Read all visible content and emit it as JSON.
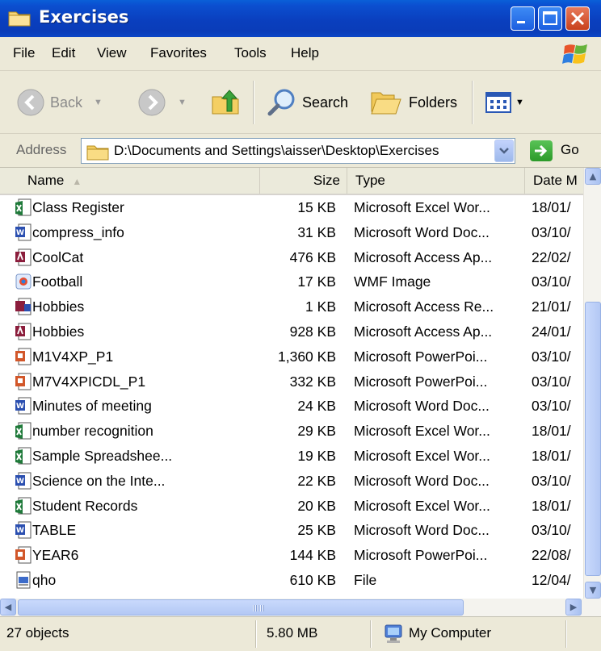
{
  "window": {
    "title": "Exercises"
  },
  "menu": [
    "File",
    "Edit",
    "View",
    "Favorites",
    "Tools",
    "Help"
  ],
  "toolbar": {
    "back": "Back",
    "search": "Search",
    "folders": "Folders"
  },
  "address": {
    "label": "Address",
    "path": "D:\\Documents and Settings\\aisser\\Desktop\\Exercises",
    "go": "Go"
  },
  "columns": {
    "name": "Name",
    "size": "Size",
    "type": "Type",
    "date": "Date M"
  },
  "files": [
    {
      "name": "Class Register",
      "size": "15 KB",
      "type": "Microsoft Excel Wor...",
      "date": "18/01/",
      "icon": "excel-file-icon"
    },
    {
      "name": "compress_info",
      "size": "31 KB",
      "type": "Microsoft Word Doc...",
      "date": "03/10/",
      "icon": "word-file-icon"
    },
    {
      "name": "CoolCat",
      "size": "476 KB",
      "type": "Microsoft Access Ap...",
      "date": "22/02/",
      "icon": "access-file-icon"
    },
    {
      "name": "Football",
      "size": "17 KB",
      "type": "WMF Image",
      "date": "03/10/",
      "icon": "image-file-icon"
    },
    {
      "name": "Hobbies",
      "size": "1 KB",
      "type": "Microsoft Access Re...",
      "date": "21/01/",
      "icon": "access-report-icon"
    },
    {
      "name": "Hobbies",
      "size": "928 KB",
      "type": "Microsoft Access Ap...",
      "date": "24/01/",
      "icon": "access-file-icon"
    },
    {
      "name": "M1V4XP_P1",
      "size": "1,360 KB",
      "type": "Microsoft PowerPoi...",
      "date": "03/10/",
      "icon": "powerpoint-file-icon"
    },
    {
      "name": "M7V4XPICDL_P1",
      "size": "332 KB",
      "type": "Microsoft PowerPoi...",
      "date": "03/10/",
      "icon": "powerpoint-file-icon"
    },
    {
      "name": "Minutes of meeting",
      "size": "24 KB",
      "type": "Microsoft Word Doc...",
      "date": "03/10/",
      "icon": "word-file-icon"
    },
    {
      "name": "number recognition",
      "size": "29 KB",
      "type": "Microsoft Excel Wor...",
      "date": "18/01/",
      "icon": "excel-file-icon"
    },
    {
      "name": "Sample Spreadshee...",
      "size": "19 KB",
      "type": "Microsoft Excel Wor...",
      "date": "18/01/",
      "icon": "excel-file-icon"
    },
    {
      "name": "Science on the Inte...",
      "size": "22 KB",
      "type": "Microsoft Word Doc...",
      "date": "03/10/",
      "icon": "word-file-icon"
    },
    {
      "name": "Student Records",
      "size": "20 KB",
      "type": "Microsoft Excel Wor...",
      "date": "18/01/",
      "icon": "excel-file-icon"
    },
    {
      "name": "TABLE",
      "size": "25 KB",
      "type": "Microsoft Word Doc...",
      "date": "03/10/",
      "icon": "word-file-icon"
    },
    {
      "name": "YEAR6",
      "size": "144 KB",
      "type": "Microsoft PowerPoi...",
      "date": "22/08/",
      "icon": "powerpoint-file-icon"
    },
    {
      "name": "qho",
      "size": "610 KB",
      "type": "File",
      "date": "12/04/",
      "icon": "generic-file-icon"
    }
  ],
  "status": {
    "objects": "27 objects",
    "total_size": "5.80 MB",
    "location": "My Computer"
  }
}
